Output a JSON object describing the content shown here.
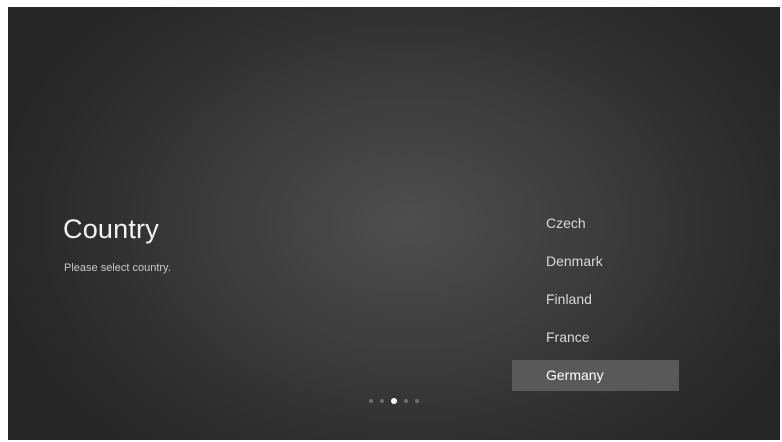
{
  "setup": {
    "title": "Country",
    "subtitle": "Please select country.",
    "countries": [
      {
        "label": "Czech",
        "selected": false
      },
      {
        "label": "Denmark",
        "selected": false
      },
      {
        "label": "Finland",
        "selected": false
      },
      {
        "label": "France",
        "selected": false
      },
      {
        "label": "Germany",
        "selected": true
      }
    ],
    "pagination": {
      "total_steps": 5,
      "current_step": 3
    }
  },
  "colors": {
    "background": "#3a3a3a",
    "selected_item": "#595959",
    "text_primary": "#f2f2f2",
    "text_secondary": "#c9c9c9"
  }
}
